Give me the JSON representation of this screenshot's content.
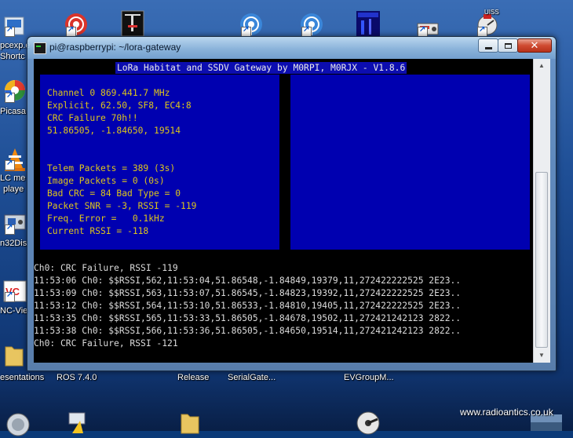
{
  "desktop": {
    "icons_top": [
      {
        "label": ""
      },
      {
        "label": ""
      },
      {
        "label": ""
      },
      {
        "label": ""
      },
      {
        "label": ""
      },
      {
        "label": ""
      },
      {
        "label": ""
      },
      {
        "label": ""
      }
    ],
    "left_labels": [
      "pcexp.e",
      "Shortc",
      "Picasa",
      "LC me",
      "playe",
      "n32Dis",
      "NC-Vie"
    ],
    "bottom_labels": [
      "esentations",
      "ROS 7.4.0",
      "Release",
      "SerialGate...",
      "EVGroupM..."
    ],
    "uiss_label": "UISS",
    "watermark": "www.radioantics.co.uk"
  },
  "window": {
    "title": "pi@raspberrypi: ~/lora-gateway",
    "buttons": {
      "minimize": "minimize",
      "maximize": "maximize",
      "close": "✕"
    }
  },
  "terminal": {
    "header": "LoRa Habitat and SSDV Gateway by M0RPI, M0RJX - V1.8.6",
    "left_panel": [
      "Channel 0 869.441.7 MHz",
      "Explicit, 62.50, SF8, EC4:8",
      "CRC Failure 70h!!",
      "51.86505, -1.84650, 19514",
      "",
      "",
      "Telem Packets = 389 (3s)",
      "Image Packets = 0 (0s)",
      "Bad CRC = 84 Bad Type = 0",
      "Packet SNR = -3, RSSI = -119",
      "Freq. Error =   0.1kHz",
      "Current RSSI = -118"
    ],
    "log": [
      "Ch0: CRC Failure, RSSI -119",
      "11:53:06 Ch0: $$RSSI,562,11:53:04,51.86548,-1.84849,19379,11,272422222525 2E23..",
      "11:53:09 Ch0: $$RSSI,563,11:53:07,51.86545,-1.84823,19392,11,272422222525 2E23..",
      "11:53:12 Ch0: $$RSSI,564,11:53:10,51.86533,-1.84810,19405,11,272422222525 2E23..",
      "11:53:35 Ch0: $$RSSI,565,11:53:33,51.86505,-1.84678,19502,11,272421242123 2822..",
      "11:53:38 Ch0: $$RSSI,566,11:53:36,51.86505,-1.84650,19514,11,272421242123 2822..",
      "Ch0: CRC Failure, RSSI -121"
    ]
  },
  "colors": {
    "panel_blue": "#0000b0",
    "panel_text": "#ddc51b",
    "terminal_bg": "#000000",
    "log_text": "#dcdcdc"
  }
}
